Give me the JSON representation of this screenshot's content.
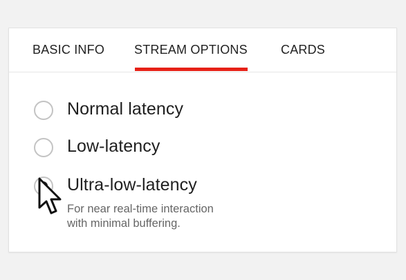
{
  "tabs": [
    {
      "label": "BASIC INFO"
    },
    {
      "label": "STREAM OPTIONS",
      "active": true
    },
    {
      "label": "CARDS"
    }
  ],
  "latency": {
    "options": [
      {
        "label": "Normal latency",
        "selected": false
      },
      {
        "label": "Low-latency",
        "selected": false
      },
      {
        "label": "Ultra-low-latency",
        "selected": true
      }
    ],
    "description_line1": "For near real-time interaction",
    "description_line2": "with minimal buffering."
  },
  "colors": {
    "accent": "#e62117",
    "text": "#222222",
    "muted": "#666666",
    "radio_border": "#c3c3c3"
  },
  "icons": {
    "cursor": "mouse-pointer-icon"
  }
}
